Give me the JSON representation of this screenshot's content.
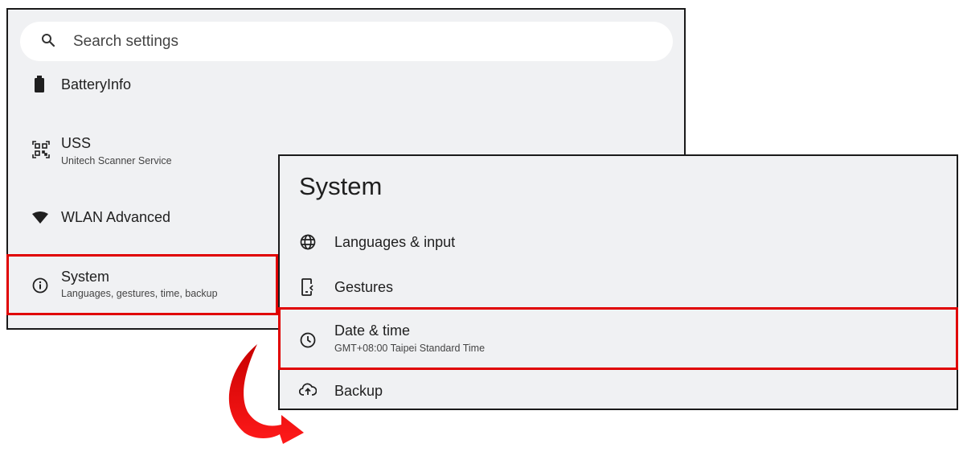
{
  "left_panel": {
    "search": {
      "placeholder": "Search settings",
      "icon": "search-icon"
    },
    "items": [
      {
        "title": "BatteryInfo",
        "subtitle": "",
        "icon": "battery-icon"
      },
      {
        "title": "USS",
        "subtitle": "Unitech Scanner Service",
        "icon": "qr-scanner-icon"
      },
      {
        "title": "WLAN Advanced",
        "subtitle": "",
        "icon": "wifi-icon"
      },
      {
        "title": "System",
        "subtitle": "Languages, gestures, time, backup",
        "icon": "info-icon"
      }
    ]
  },
  "right_panel": {
    "title": "System",
    "items": [
      {
        "title": "Languages & input",
        "subtitle": "",
        "icon": "globe-icon"
      },
      {
        "title": "Gestures",
        "subtitle": "",
        "icon": "gesture-phone-icon"
      },
      {
        "title": "Date & time",
        "subtitle": "GMT+08:00 Taipei Standard Time",
        "icon": "clock-icon"
      },
      {
        "title": "Backup",
        "subtitle": "",
        "icon": "cloud-backup-icon"
      }
    ]
  },
  "colors": {
    "highlight": "#e00000",
    "panel_bg": "#f0f1f3",
    "arrow": "#e00000"
  }
}
